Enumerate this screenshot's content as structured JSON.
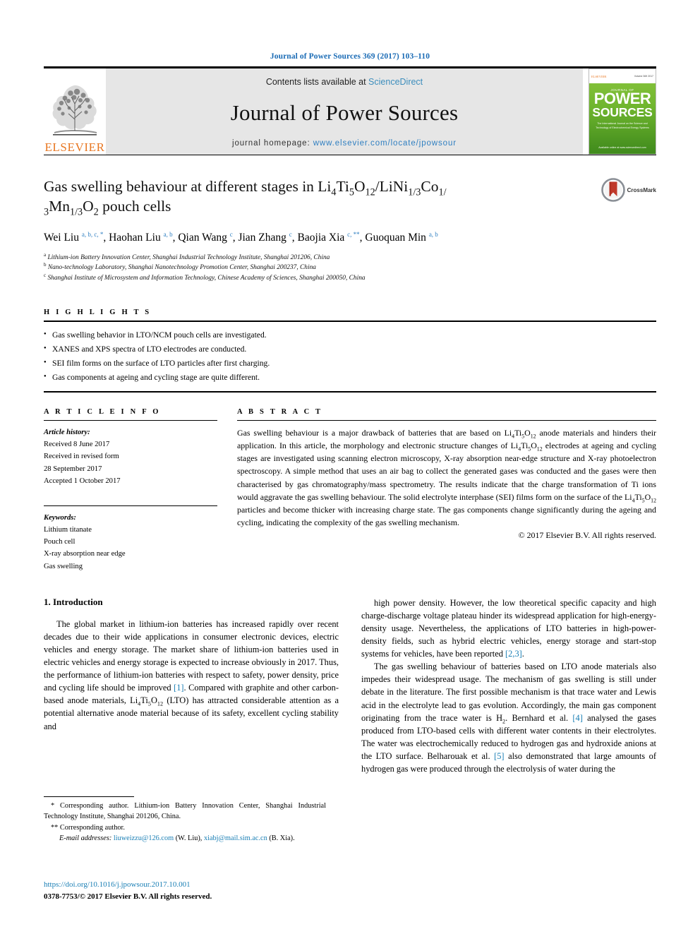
{
  "running_head": "Journal of Power Sources 369 (2017) 103–110",
  "masthead": {
    "contents_prefix": "Contents lists available at ",
    "sciencedirect": "ScienceDirect",
    "journal_name": "Journal of Power Sources",
    "homepage_prefix": "journal homepage: ",
    "homepage_url": "www.elsevier.com/locate/jpowsour",
    "publisher_word": "ELSEVIER",
    "publisher_color": "#E87722",
    "link_color": "#2f7fc1",
    "cover": {
      "kicker": "JOURNAL OF",
      "line1": "POWER",
      "line2": "SOURCES",
      "sub": "The International Journal on the Science and Technology of Electrochemical Energy Systems",
      "foot": "Available online at\nwww.sciencedirect.com",
      "mini_els": "ELSEVIER",
      "mini_issue": "Volume 369  2017"
    }
  },
  "article": {
    "title_html": "Gas swelling behaviour at different stages in Li<sub>4</sub>Ti<sub>5</sub>O<sub>12</sub>/LiNi<sub>1/3</sub>Co<sub>1/</sub><br><sub>3</sub>Mn<sub>1/3</sub>O<sub>2</sub> pouch cells",
    "crossmark_label": "CrossMark",
    "authors_html": "Wei Liu <sup>a, b, c, *</sup>, Haohan Liu <sup>a, b</sup>, Qian Wang <sup>c</sup>, Jian Zhang <sup>c</sup>, Baojia Xia <sup>c, **</sup>, Guoquan Min <sup>a, b</sup>",
    "affiliations": [
      {
        "marker": "a",
        "text": "Lithium-ion Battery Innovation Center, Shanghai Industrial Technology Institute, Shanghai 201206, China"
      },
      {
        "marker": "b",
        "text": "Nano-technology Laboratory, Shanghai Nanotechnology Promotion Center, Shanghai 200237, China"
      },
      {
        "marker": "c",
        "text": "Shanghai Institute of Microsystem and Information Technology, Chinese Academy of Sciences, Shanghai 200050, China"
      }
    ]
  },
  "highlights": {
    "heading": "H I G H L I G H T S",
    "items": [
      "Gas swelling behavior in LTO/NCM pouch cells are investigated.",
      "XANES and XPS spectra of LTO electrodes are conducted.",
      "SEI film forms on the surface of LTO particles after first charging.",
      "Gas components at ageing and cycling stage are quite different."
    ]
  },
  "article_info": {
    "heading": "A R T I C L E  I N F O",
    "history_label": "Article history:",
    "history_lines": [
      "Received 8 June 2017",
      "Received in revised form",
      "28 September 2017",
      "Accepted 1 October 2017"
    ],
    "keywords_label": "Keywords:",
    "keywords": [
      "Lithium titanate",
      "Pouch cell",
      "X-ray absorption near edge",
      "Gas swelling"
    ]
  },
  "abstract": {
    "heading": "A B S T R A C T",
    "paragraph_html": "Gas swelling behaviour is a major drawback of batteries that are based on Li<sub>4</sub>Ti<sub>5</sub>O<sub>12</sub> anode materials and hinders their application. In this article, the morphology and electronic structure changes of Li<sub>4</sub>Ti<sub>5</sub>O<sub>12</sub> electrodes at ageing and cycling stages are investigated using scanning electron microscopy, X-ray absorption near-edge structure and X-ray photoelectron spectroscopy. A simple method that uses an air bag to collect the generated gases was conducted and the gases were then characterised by gas chromatography/mass spectrometry. The results indicate that the charge transformation of Ti ions would aggravate the gas swelling behaviour. The solid electrolyte interphase (SEI) films form on the surface of the Li<sub>4</sub>Ti<sub>5</sub>O<sub>12</sub> particles and become thicker with increasing charge state. The gas components change significantly during the ageing and cycling, indicating the complexity of the gas swelling mechanism.",
    "copyright": "© 2017 Elsevier B.V. All rights reserved."
  },
  "body": {
    "section_number_title": "1.  Introduction",
    "left_paragraphs_html": [
      "The global market in lithium-ion batteries has increased rapidly over recent decades due to their wide applications in consumer electronic devices, electric vehicles and energy storage. The market share of lithium-ion batteries used in electric vehicles and energy storage is expected to increase obviously in 2017. Thus, the performance of lithium-ion batteries with respect to safety, power density, price and cycling life should be improved <span class=\"ref\">[1]</span>. Compared with graphite and other carbon-based anode materials, Li<sub>4</sub>Ti<sub>5</sub>O<sub>12</sub> (LTO) has attracted considerable attention as a potential alternative anode material because of its safety, excellent cycling stability and"
    ],
    "right_paragraphs_html": [
      "high power density. However, the low theoretical specific capacity and high charge-discharge voltage plateau hinder its widespread application for high-energy-density usage. Nevertheless, the applications of LTO batteries in high-power-density fields, such as hybrid electric vehicles, energy storage and start-stop systems for vehicles, have been reported <span class=\"ref\">[2,3]</span>.",
      "The gas swelling behaviour of batteries based on LTO anode materials also impedes their widespread usage. The mechanism of gas swelling is still under debate in the literature. The first possible mechanism is that trace water and Lewis acid in the electrolyte lead to gas evolution. Accordingly, the main gas component originating from the trace water is H<sub>2</sub>. Bernhard et al. <span class=\"ref\">[4]</span> analysed the gases produced from LTO-based cells with different water contents in their electrolytes. The water was electrochemically reduced to hydrogen gas and hydroxide anions at the LTO surface. Belharouak et al. <span class=\"ref\">[5]</span> also demonstrated that large amounts of hydrogen gas were produced through the electrolysis of water during the"
    ]
  },
  "footnotes": {
    "corresponding_1_html": "* Corresponding author. Lithium-ion Battery Innovation Center, Shanghai Industrial Technology Institute, Shanghai 201206, China.",
    "corresponding_2_html": "** Corresponding author.",
    "email_label": "E-mail addresses:",
    "email_1": "liuweizzu@126.com",
    "email_1_owner": "(W. Liu)",
    "email_2": "xiabj@mail.sim.ac.cn",
    "email_2_owner": "(B. Xia)",
    "doi": "https://doi.org/10.1016/j.jpowsour.2017.10.001",
    "issn_line": "0378-7753/© 2017 Elsevier B.V. All rights reserved."
  }
}
